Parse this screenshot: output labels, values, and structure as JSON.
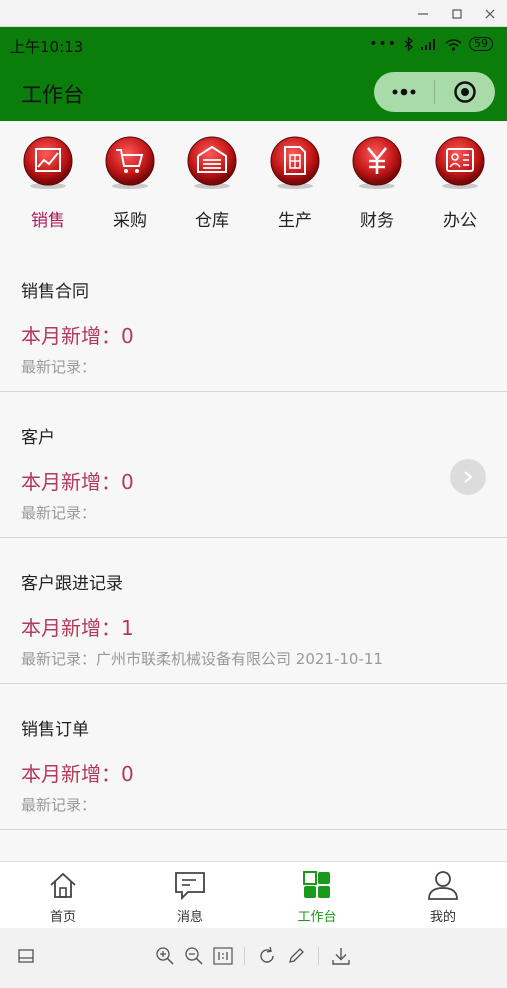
{
  "window": {
    "minimize_icon": "minimize-icon",
    "maximize_icon": "maximize-icon",
    "close_icon": "close-icon"
  },
  "status": {
    "time": "上午10:13",
    "battery": "59"
  },
  "header": {
    "title": "工作台"
  },
  "categories": [
    {
      "label": "销售",
      "icon": "chart-icon",
      "active": true
    },
    {
      "label": "采购",
      "icon": "cart-icon",
      "active": false
    },
    {
      "label": "仓库",
      "icon": "warehouse-icon",
      "active": false
    },
    {
      "label": "生产",
      "icon": "document-icon",
      "active": false
    },
    {
      "label": "财务",
      "icon": "yen-icon",
      "active": false
    },
    {
      "label": "办公",
      "icon": "office-icon",
      "active": false
    }
  ],
  "cards": [
    {
      "title": "销售合同",
      "stat": "本月新增：0",
      "recent": "最新记录："
    },
    {
      "title": "客户",
      "stat": "本月新增：0",
      "recent": "最新记录："
    },
    {
      "title": "客户跟进记录",
      "stat": "本月新增：1",
      "recent": "最新记录：广州市联柔机械设备有限公司 2021-10-11"
    },
    {
      "title": "销售订单",
      "stat": "本月新增：0",
      "recent": "最新记录："
    }
  ],
  "tabs": [
    {
      "label": "首页",
      "icon": "home-icon",
      "active": false
    },
    {
      "label": "消息",
      "icon": "message-icon",
      "active": false
    },
    {
      "label": "工作台",
      "icon": "workbench-icon",
      "active": true
    },
    {
      "label": "我的",
      "icon": "user-icon",
      "active": false
    }
  ],
  "colors": {
    "header_green": "#0a7d0a",
    "accent_red": "#b23a5a",
    "tab_active": "#1a9a1a",
    "icon_red": "#c21616"
  }
}
